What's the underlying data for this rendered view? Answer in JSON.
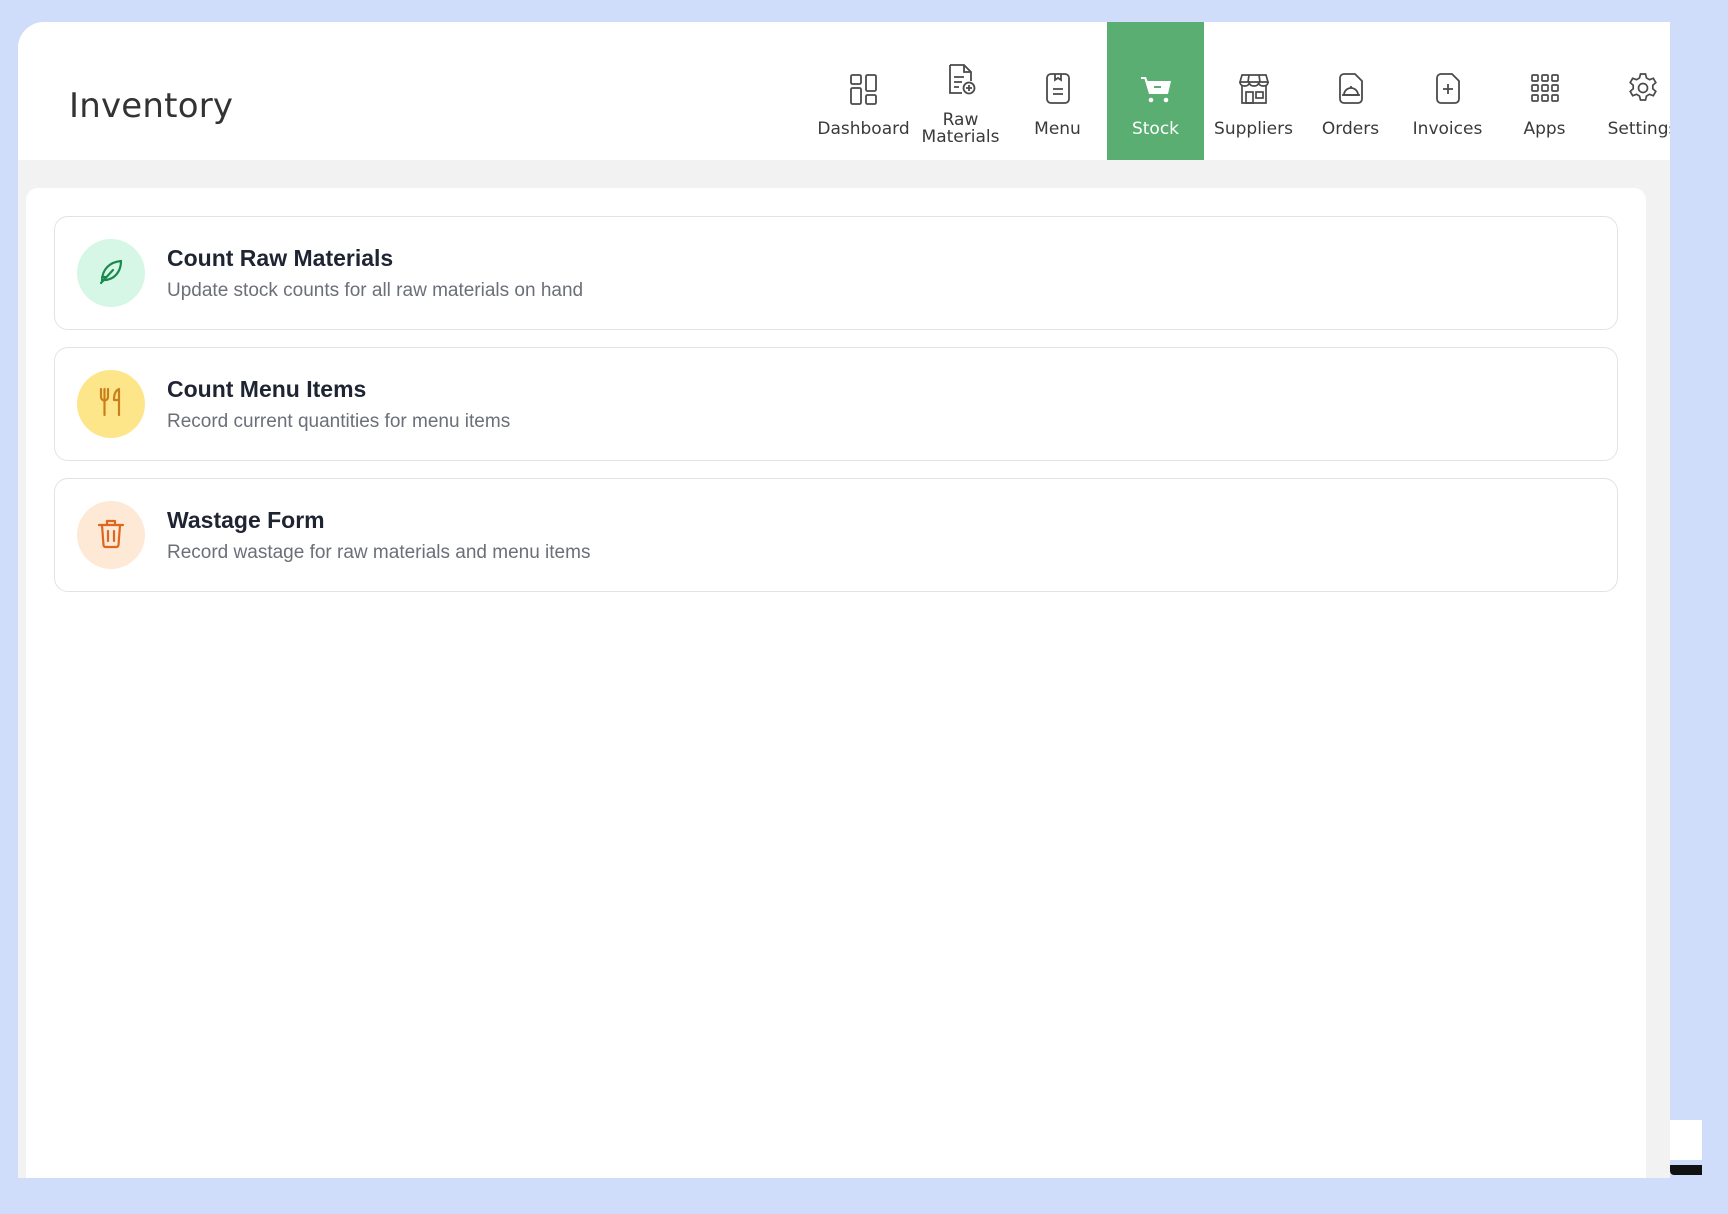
{
  "header": {
    "title": "Inventory"
  },
  "nav": {
    "items": [
      {
        "label": "Dashboard",
        "icon": "dashboard-icon"
      },
      {
        "label": "Raw\nMaterials",
        "label_line1": "Raw",
        "label_line2": "Materials",
        "icon": "raw-materials-icon"
      },
      {
        "label": "Menu",
        "icon": "menu-icon"
      },
      {
        "label": "Stock",
        "icon": "cart-icon",
        "active": true
      },
      {
        "label": "Suppliers",
        "icon": "store-icon"
      },
      {
        "label": "Orders",
        "icon": "orders-icon"
      },
      {
        "label": "Invoices",
        "icon": "invoice-icon"
      },
      {
        "label": "Apps",
        "icon": "apps-grid-icon"
      },
      {
        "label": "Settings",
        "icon": "gear-icon"
      }
    ]
  },
  "cards": [
    {
      "title": "Count Raw Materials",
      "description": "Update stock counts for all raw materials on hand",
      "icon": "leaf-icon",
      "bg": "#d6f7e6",
      "color": "#1a8a4c"
    },
    {
      "title": "Count Menu Items",
      "description": "Record current quantities for menu items",
      "icon": "utensils-icon",
      "bg": "#fde58a",
      "color": "#c9801a"
    },
    {
      "title": "Wastage Form",
      "description": "Record wastage for raw materials and menu items",
      "icon": "trash-icon",
      "bg": "#fde9d6",
      "color": "#e0661f"
    }
  ],
  "colors": {
    "accent": "#5aae72",
    "frame": "#cfddfa"
  }
}
